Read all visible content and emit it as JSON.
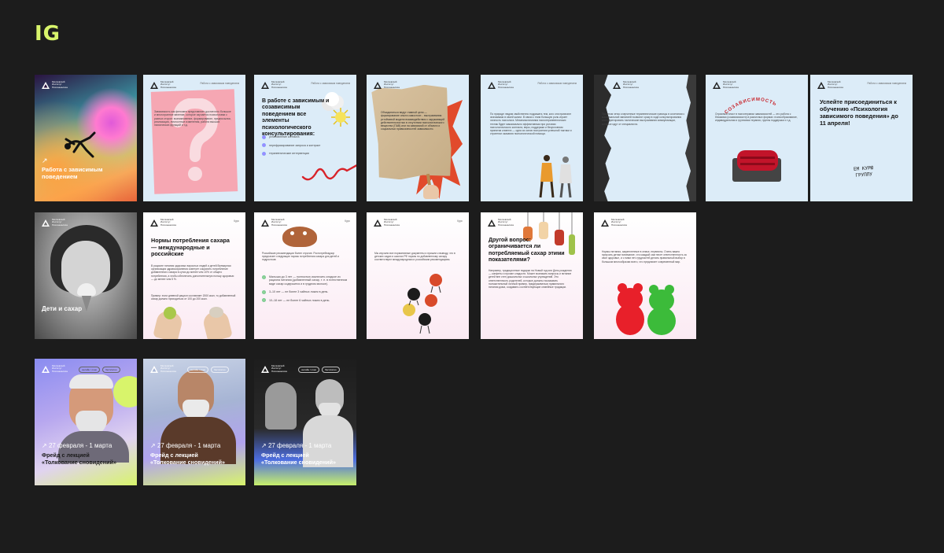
{
  "page": {
    "title": "IG"
  },
  "org": {
    "logo_text": "Московский Институт Психоанализа"
  },
  "header_text": "Работа с зависимым поведением",
  "lecture_header": "Курс",
  "row1": [
    {
      "caption": "Работа с зависимым поведением"
    },
    {
      "body": "Зависимость как феномен представляет достаточно большое и многогранное явление, которое изучается психологами с разных сторон: возникновение, формирование, предпосылки, реализация, личностные изменения, работа высших психических функций и т.д."
    },
    {
      "heading": "В работе с зависимым и созависимым поведением все элементы психологического консультирования:",
      "bullets": [
        "установление контакта",
        "перефразирование запроса и контракт",
        "терапевтические интервенции"
      ]
    },
    {
      "body": "Объединяться ведут главной цели — формирование опыта самостоят... выстраивания устойчивой модели взаимодействия с окружающей действительностью в отсутствии психологического вещества (ПАВ) или на зависимой от объекта и социальных привязанностей зависимости."
    },
    {
      "body": "По природе людям свойственно подражать тем, кого они признают значимыми в своей жизни. В связи с этим большую роль играет личность психолога. Механизм влияния психотерапевтических техник будет максимально эффективным при условии психологического контакта, веры, поддержки и безусловном принятии клиента — одна из основ построения успешной тактики и стратегии оказания психологической помощи."
    },
    {
      "body": "При этом четко очерченные терапевтические границы в сочетании с максимальной эмпатией позволят сразу в ходе консультирования интерпретировать тактические выстраивания коммуникации, которые идут от специалиста."
    },
    {
      "arc_text": "СОЗАВИСИМОСТЬ",
      "body": "Огромный пласт в психотерапии зависимостей — это работа с близкими (созависимости) в различных формах: психообразование, индивидуальная и групповая терапия, группы поддержки и т.д."
    },
    {
      "heading": "Успейте присоединиться к обучению «Психология зависимого поведения» до 11 апреля!",
      "handwritten": "ЕМ КУРЮ ГРУППУ"
    }
  ],
  "row2": [
    {
      "caption": "Дети и сахар"
    },
    {
      "heading": "Нормы потребления сахара — международные и российские",
      "body1": "В рационе питания здоровых взрослых людей и детей Всемирная организация здравоохранения советует сократить потребление добавленного сахара в сутки до менее чем 10% от общего потребления, а чтобы обеспечить дополнительную пользу здоровью — до менее чем 5 %.",
      "body2": "Пример: если дневной рацион составляет 2000 ккал, то добавленный сахар должно приходиться от 100 до 200 ккал."
    },
    {
      "body": "Российские рекомендации более строгие. Роспотребнадзор предлагает следующие нормы потребления сахара для детей и подростков:",
      "bullets": [
        "Малыши до 3 лет — полностью исключить сладкое из рациона питания (добавленный сахар, т. е. в естественном виде сахар содержится и в грудном молоке).",
        "3–10 лет — не более 3 чайных ложек в день.",
        "10–18 лет — не более 6 чайных ложек в день."
      ]
    },
    {
      "body": "Мы изучили все нормативные документы и пришли к выводу, что в детских садах и школах РФ нормы по добавленному сахару соответствуют международным и российским рекомендациям."
    },
    {
      "heading": "Другой вопрос: ограничивается ли потребляемый сахар этими показателями?",
      "body": "Например, традиционные подарки на Новый год или День рождения — конфеты и прочие сладости. Может возникать вопросы и питание детей вне стен дошкольных и школьных учреждений. Это ответственность родителей, которые должны показывать положительный личный пример, придерживаться правильного питания дома, создавать соответствующие семейные традиции."
    },
    {
      "body": "Нормы питания, закрепленные в семье, первичны. Очень важно приучать детям понимание, что каждый сам несет ответственность за свое здоровье, и с ними нет-трудностей делать правильный выбор в большом многообразии всего, что предлагает современный мир."
    }
  ],
  "row3": [
    {
      "tags": [
        "онлайн / очно",
        "бесплатно"
      ],
      "date": "27 февраля - 1 марта",
      "title_line1": "Фрейд с лекцией",
      "title_line2": "«Толкование сновидений»"
    },
    {
      "tags": [
        "онлайн / очно",
        "бесплатно"
      ],
      "date": "27 февраля - 1 марта",
      "title_line1": "Фрейд с лекцией",
      "title_line2": "«Толкование сновидений»"
    },
    {
      "tags": [
        "онлайн / очно",
        "бесплатно"
      ],
      "date": "27 февраля - 1 марта",
      "title_line1": "Фрейд с лекцией",
      "title_line2": "«Толкование сновидений»"
    }
  ],
  "colors": {
    "accent": "#d8f46b",
    "bg": "#1c1c1c",
    "light_blue": "#dcecf8",
    "pink_card": "#fbe8f0",
    "dark": "#1d1d1d"
  }
}
